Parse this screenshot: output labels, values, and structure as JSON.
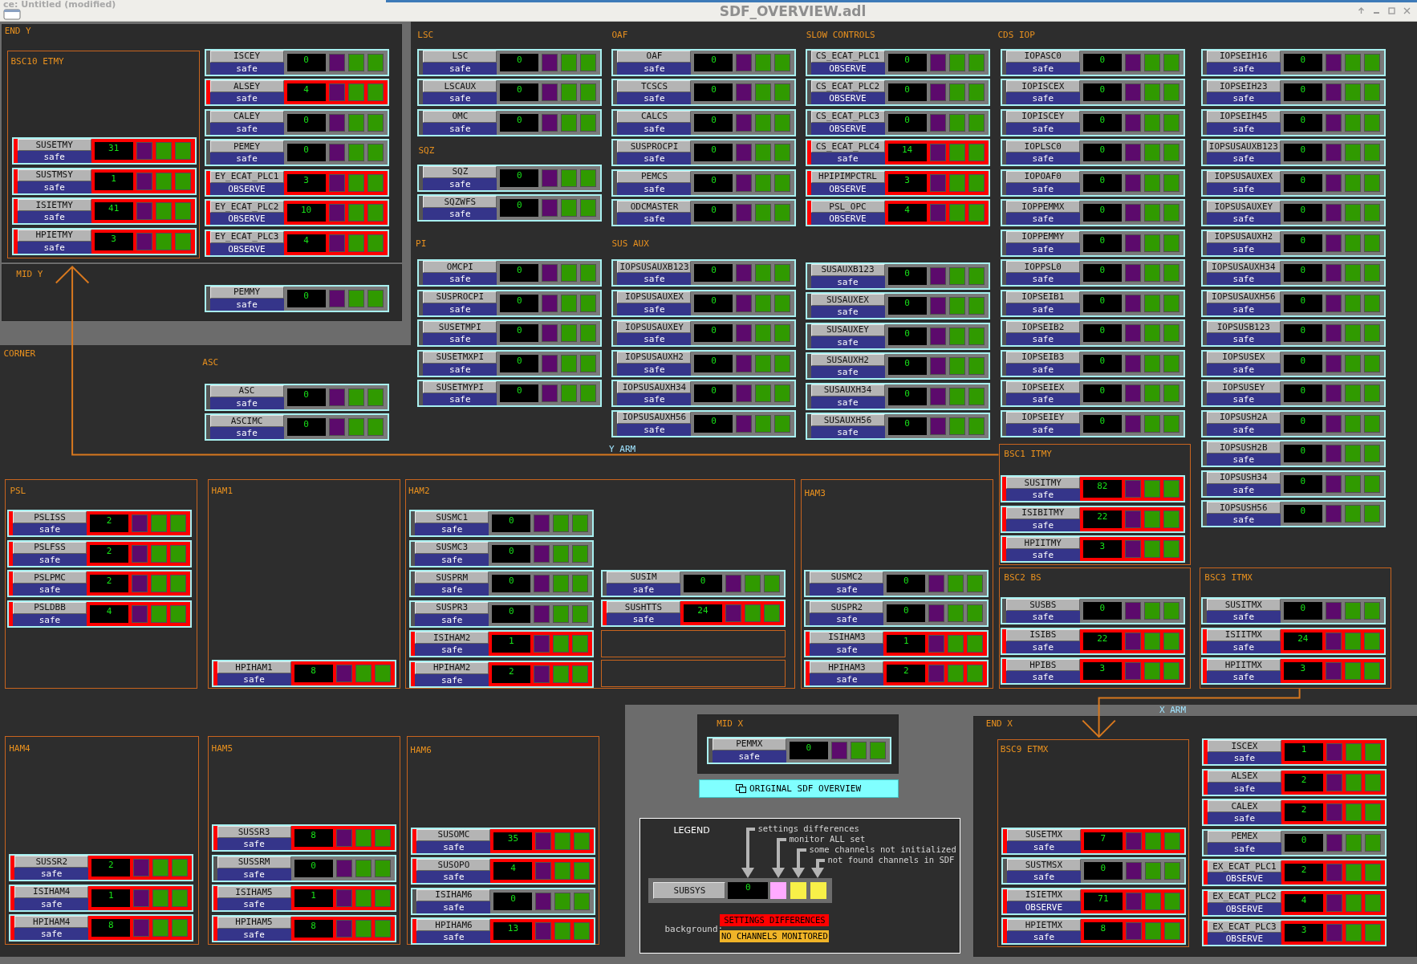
{
  "window": {
    "behind_title": "ce: Untitled (modified)",
    "title": "SDF_OVERVIEW.adl"
  },
  "sections": [
    {
      "kind": "panel",
      "label": "END Y"
    },
    {
      "kind": "box",
      "label": "BSC10 ETMY",
      "widgets": [
        {
          "name": "SUSETMY",
          "mode": "safe",
          "count": "31",
          "alarm": true
        },
        {
          "name": "SUSTMSY",
          "mode": "safe",
          "count": "1",
          "alarm": true
        },
        {
          "name": "ISIETMY",
          "mode": "safe",
          "count": "41",
          "alarm": true
        },
        {
          "name": "HPIETMY",
          "mode": "safe",
          "count": "3",
          "alarm": true
        }
      ]
    },
    {
      "kind": "column",
      "widgets": [
        {
          "name": "ISCEY",
          "mode": "safe",
          "count": "0",
          "alarm": false
        },
        {
          "name": "ALSEY",
          "mode": "safe",
          "count": "4",
          "alarm": true
        },
        {
          "name": "CALEY",
          "mode": "safe",
          "count": "0",
          "alarm": false
        },
        {
          "name": "PEMEY",
          "mode": "safe",
          "count": "0",
          "alarm": false
        },
        {
          "name": "EY_ECAT_PLC1",
          "mode": "OBSERVE",
          "count": "3",
          "alarm": true
        },
        {
          "name": "EY_ECAT_PLC2",
          "mode": "OBSERVE",
          "count": "10",
          "alarm": true
        },
        {
          "name": "EY_ECAT_PLC3",
          "mode": "OBSERVE",
          "count": "4",
          "alarm": true
        }
      ]
    },
    {
      "kind": "panel",
      "label": "MID Y"
    },
    {
      "kind": "column",
      "widgets": [
        {
          "name": "PEMMY",
          "mode": "safe",
          "count": "0",
          "alarm": false
        }
      ]
    },
    {
      "kind": "column",
      "label": "LSC",
      "widgets": [
        {
          "name": "LSC",
          "mode": "safe",
          "count": "0",
          "alarm": false
        },
        {
          "name": "LSCAUX",
          "mode": "safe",
          "count": "0",
          "alarm": false
        },
        {
          "name": "OMC",
          "mode": "safe",
          "count": "0",
          "alarm": false
        }
      ]
    },
    {
      "kind": "column",
      "label": "SQZ",
      "widgets": [
        {
          "name": "SQZ",
          "mode": "safe",
          "count": "0",
          "alarm": false
        },
        {
          "name": "SQZWFS",
          "mode": "safe",
          "count": "0",
          "alarm": false
        }
      ]
    },
    {
      "kind": "column",
      "label": "PI",
      "widgets": [
        {
          "name": "OMCPI",
          "mode": "safe",
          "count": "0",
          "alarm": false
        },
        {
          "name": "SUSPROCPI",
          "mode": "safe",
          "count": "0",
          "alarm": false
        },
        {
          "name": "SUSETMPI",
          "mode": "safe",
          "count": "0",
          "alarm": false
        },
        {
          "name": "SUSETMXPI",
          "mode": "safe",
          "count": "0",
          "alarm": false
        },
        {
          "name": "SUSETMYPI",
          "mode": "safe",
          "count": "0",
          "alarm": false
        }
      ]
    },
    {
      "kind": "column",
      "label": "OAF",
      "widgets": [
        {
          "name": "OAF",
          "mode": "safe",
          "count": "0",
          "alarm": false
        },
        {
          "name": "TCSCS",
          "mode": "safe",
          "count": "0",
          "alarm": false
        },
        {
          "name": "CALCS",
          "mode": "safe",
          "count": "0",
          "alarm": false
        },
        {
          "name": "SUSPROCPI",
          "mode": "safe",
          "count": "0",
          "alarm": false
        },
        {
          "name": "PEMCS",
          "mode": "safe",
          "count": "0",
          "alarm": false
        },
        {
          "name": "ODCMASTER",
          "mode": "safe",
          "count": "0",
          "alarm": false
        }
      ]
    },
    {
      "kind": "column",
      "label": "SUS AUX",
      "widgets": [
        {
          "name": "IOPSUSAUXB123",
          "mode": "safe",
          "count": "0",
          "alarm": false
        },
        {
          "name": "IOPSUSAUXEX",
          "mode": "safe",
          "count": "0",
          "alarm": false
        },
        {
          "name": "IOPSUSAUXEY",
          "mode": "safe",
          "count": "0",
          "alarm": false
        },
        {
          "name": "IOPSUSAUXH2",
          "mode": "safe",
          "count": "0",
          "alarm": false
        },
        {
          "name": "IOPSUSAUXH34",
          "mode": "safe",
          "count": "0",
          "alarm": false
        },
        {
          "name": "IOPSUSAUXH56",
          "mode": "safe",
          "count": "0",
          "alarm": false
        }
      ]
    },
    {
      "kind": "column",
      "label": "SLOW CONTROLS",
      "widgets": [
        {
          "name": "CS_ECAT_PLC1",
          "mode": "OBSERVE",
          "count": "0",
          "alarm": false
        },
        {
          "name": "CS_ECAT_PLC2",
          "mode": "OBSERVE",
          "count": "0",
          "alarm": false
        },
        {
          "name": "CS_ECAT_PLC3",
          "mode": "OBSERVE",
          "count": "0",
          "alarm": false
        },
        {
          "name": "CS_ECAT_PLC4",
          "mode": "safe",
          "count": "14",
          "alarm": true
        },
        {
          "name": "HPIPIMPCTRL",
          "mode": "OBSERVE",
          "count": "3",
          "alarm": true
        },
        {
          "name": "PSL_OPC",
          "mode": "OBSERVE",
          "count": "4",
          "alarm": true
        }
      ]
    },
    {
      "kind": "column",
      "widgets": [
        {
          "name": "SUSAUXB123",
          "mode": "safe",
          "count": "0",
          "alarm": false
        },
        {
          "name": "SUSAUXEX",
          "mode": "safe",
          "count": "0",
          "alarm": false
        },
        {
          "name": "SUSAUXEY",
          "mode": "safe",
          "count": "0",
          "alarm": false
        },
        {
          "name": "SUSAUXH2",
          "mode": "safe",
          "count": "0",
          "alarm": false
        },
        {
          "name": "SUSAUXH34",
          "mode": "safe",
          "count": "0",
          "alarm": false
        },
        {
          "name": "SUSAUXH56",
          "mode": "safe",
          "count": "0",
          "alarm": false
        }
      ]
    },
    {
      "kind": "column",
      "label": "CDS IOP",
      "widgets": [
        {
          "name": "IOPASC0",
          "mode": "safe",
          "count": "0",
          "alarm": false
        },
        {
          "name": "IOPISCEX",
          "mode": "safe",
          "count": "0",
          "alarm": false
        },
        {
          "name": "IOPISCEY",
          "mode": "safe",
          "count": "0",
          "alarm": false
        },
        {
          "name": "IOPLSC0",
          "mode": "safe",
          "count": "0",
          "alarm": false
        },
        {
          "name": "IOPOAF0",
          "mode": "safe",
          "count": "0",
          "alarm": false
        },
        {
          "name": "IOPPEMMX",
          "mode": "safe",
          "count": "0",
          "alarm": false
        },
        {
          "name": "IOPPEMMY",
          "mode": "safe",
          "count": "0",
          "alarm": false
        },
        {
          "name": "IOPPSL0",
          "mode": "safe",
          "count": "0",
          "alarm": false
        },
        {
          "name": "IOPSEIB1",
          "mode": "safe",
          "count": "0",
          "alarm": false
        },
        {
          "name": "IOPSEIB2",
          "mode": "safe",
          "count": "0",
          "alarm": false
        },
        {
          "name": "IOPSEIB3",
          "mode": "safe",
          "count": "0",
          "alarm": false
        },
        {
          "name": "IOPSEIEX",
          "mode": "safe",
          "count": "0",
          "alarm": false
        },
        {
          "name": "IOPSEIEY",
          "mode": "safe",
          "count": "0",
          "alarm": false
        }
      ]
    },
    {
      "kind": "column",
      "widgets": [
        {
          "name": "IOPSEIH16",
          "mode": "safe",
          "count": "0",
          "alarm": false
        },
        {
          "name": "IOPSEIH23",
          "mode": "safe",
          "count": "0",
          "alarm": false
        },
        {
          "name": "IOPSEIH45",
          "mode": "safe",
          "count": "0",
          "alarm": false
        },
        {
          "name": "IOPSUSAUXB123",
          "mode": "safe",
          "count": "0",
          "alarm": false
        },
        {
          "name": "IOPSUSAUXEX",
          "mode": "safe",
          "count": "0",
          "alarm": false
        },
        {
          "name": "IOPSUSAUXEY",
          "mode": "safe",
          "count": "0",
          "alarm": false
        },
        {
          "name": "IOPSUSAUXH2",
          "mode": "safe",
          "count": "0",
          "alarm": false
        },
        {
          "name": "IOPSUSAUXH34",
          "mode": "safe",
          "count": "0",
          "alarm": false
        },
        {
          "name": "IOPSUSAUXH56",
          "mode": "safe",
          "count": "0",
          "alarm": false
        },
        {
          "name": "IOPSUSB123",
          "mode": "safe",
          "count": "0",
          "alarm": false
        },
        {
          "name": "IOPSUSEX",
          "mode": "safe",
          "count": "0",
          "alarm": false
        },
        {
          "name": "IOPSUSEY",
          "mode": "safe",
          "count": "0",
          "alarm": false
        },
        {
          "name": "IOPSUSH2A",
          "mode": "safe",
          "count": "0",
          "alarm": false
        },
        {
          "name": "IOPSUSH2B",
          "mode": "safe",
          "count": "0",
          "alarm": false
        },
        {
          "name": "IOPSUSH34",
          "mode": "safe",
          "count": "0",
          "alarm": false
        },
        {
          "name": "IOPSUSH56",
          "mode": "safe",
          "count": "0",
          "alarm": false
        }
      ]
    },
    {
      "kind": "label",
      "label": "CORNER"
    },
    {
      "kind": "column",
      "label": "ASC",
      "widgets": [
        {
          "name": "ASC",
          "mode": "safe",
          "count": "0",
          "alarm": false
        },
        {
          "name": "ASCIMC",
          "mode": "safe",
          "count": "0",
          "alarm": false
        }
      ]
    },
    {
      "kind": "box",
      "label": "BSC1 ITMY",
      "widgets": [
        {
          "name": "SUSITMY",
          "mode": "safe",
          "count": "82",
          "alarm": true
        },
        {
          "name": "ISIBITMY",
          "mode": "safe",
          "count": "22",
          "alarm": true
        },
        {
          "name": "HPIITMY",
          "mode": "safe",
          "count": "3",
          "alarm": true
        }
      ]
    },
    {
      "kind": "arm",
      "label": "Y ARM"
    },
    {
      "kind": "box",
      "label": "PSL",
      "widgets": [
        {
          "name": "PSLISS",
          "mode": "safe",
          "count": "2",
          "alarm": true
        },
        {
          "name": "PSLFSS",
          "mode": "safe",
          "count": "2",
          "alarm": true
        },
        {
          "name": "PSLPMC",
          "mode": "safe",
          "count": "2",
          "alarm": true
        },
        {
          "name": "PSLDBB",
          "mode": "safe",
          "count": "4",
          "alarm": true
        }
      ]
    },
    {
      "kind": "box",
      "label": "HAM1",
      "widgets": [
        {
          "name": "HPIHAM1",
          "mode": "safe",
          "count": "8",
          "alarm": true
        }
      ]
    },
    {
      "kind": "box",
      "label": "HAM2",
      "widgets": [
        {
          "name": "SUSMC1",
          "mode": "safe",
          "count": "0",
          "alarm": false
        },
        {
          "name": "SUSMC3",
          "mode": "safe",
          "count": "0",
          "alarm": false
        },
        {
          "name": "SUSPRM",
          "mode": "safe",
          "count": "0",
          "alarm": false
        },
        {
          "name": "SUSPR3",
          "mode": "safe",
          "count": "0",
          "alarm": false
        },
        {
          "name": "ISIHAM2",
          "mode": "safe",
          "count": "1",
          "alarm": true
        },
        {
          "name": "HPIHAM2",
          "mode": "safe",
          "count": "2",
          "alarm": true
        }
      ]
    },
    {
      "kind": "column",
      "widgets": [
        {
          "name": "SUSIM",
          "mode": "safe",
          "count": "0",
          "alarm": false
        },
        {
          "name": "SUSHTTS",
          "mode": "safe",
          "count": "24",
          "alarm": true
        }
      ]
    },
    {
      "kind": "box",
      "label": "HAM3",
      "widgets": [
        {
          "name": "SUSMC2",
          "mode": "safe",
          "count": "0",
          "alarm": false
        },
        {
          "name": "SUSPR2",
          "mode": "safe",
          "count": "0",
          "alarm": false
        },
        {
          "name": "ISIHAM3",
          "mode": "safe",
          "count": "1",
          "alarm": true
        },
        {
          "name": "HPIHAM3",
          "mode": "safe",
          "count": "2",
          "alarm": true
        }
      ]
    },
    {
      "kind": "box",
      "label": "BSC2 BS",
      "widgets": [
        {
          "name": "SUSBS",
          "mode": "safe",
          "count": "0",
          "alarm": false
        },
        {
          "name": "ISIBS",
          "mode": "safe",
          "count": "22",
          "alarm": true
        },
        {
          "name": "HPIBS",
          "mode": "safe",
          "count": "3",
          "alarm": true
        }
      ]
    },
    {
      "kind": "box",
      "label": "BSC3 ITMX",
      "widgets": [
        {
          "name": "SUSITMX",
          "mode": "safe",
          "count": "0",
          "alarm": false
        },
        {
          "name": "ISIITMX",
          "mode": "safe",
          "count": "24",
          "alarm": true
        },
        {
          "name": "HPIITMX",
          "mode": "safe",
          "count": "3",
          "alarm": true
        }
      ]
    },
    {
      "kind": "arm",
      "label": "X ARM"
    },
    {
      "kind": "box",
      "label": "HAM4",
      "widgets": [
        {
          "name": "SUSSR2",
          "mode": "safe",
          "count": "2",
          "alarm": true
        },
        {
          "name": "ISIHAM4",
          "mode": "safe",
          "count": "1",
          "alarm": true
        },
        {
          "name": "HPIHAM4",
          "mode": "safe",
          "count": "8",
          "alarm": true
        }
      ]
    },
    {
      "kind": "box",
      "label": "HAM5",
      "widgets": [
        {
          "name": "SUSSR3",
          "mode": "safe",
          "count": "8",
          "alarm": true
        },
        {
          "name": "SUSSRM",
          "mode": "safe",
          "count": "0",
          "alarm": false
        },
        {
          "name": "ISIHAM5",
          "mode": "safe",
          "count": "1",
          "alarm": true
        },
        {
          "name": "HPIHAM5",
          "mode": "safe",
          "count": "8",
          "alarm": true
        }
      ]
    },
    {
      "kind": "box",
      "label": "HAM6",
      "widgets": [
        {
          "name": "SUSOMC",
          "mode": "safe",
          "count": "35",
          "alarm": true
        },
        {
          "name": "SUSOPO",
          "mode": "safe",
          "count": "4",
          "alarm": true
        },
        {
          "name": "ISIHAM6",
          "mode": "safe",
          "count": "0",
          "alarm": false
        },
        {
          "name": "HPIHAM6",
          "mode": "safe",
          "count": "13",
          "alarm": true
        }
      ]
    },
    {
      "kind": "panel",
      "label": "MID X",
      "widgets": [
        {
          "name": "PEMMX",
          "mode": "safe",
          "count": "0",
          "alarm": false
        }
      ]
    },
    {
      "kind": "button",
      "label": "ORIGINAL SDF OVERVIEW"
    },
    {
      "kind": "legend",
      "title": "LEGEND",
      "notes": [
        "settings differences",
        "monitor ALL set",
        "some channels not initialized",
        "not found channels in SDF"
      ],
      "sample": {
        "name": "SUBSYS",
        "count": "0"
      },
      "indicators": [
        {
          "color": "#ffaaff"
        },
        {
          "color": "#f8f048"
        },
        {
          "color": "#f8f048"
        }
      ],
      "background_label": "background:",
      "tags": [
        {
          "text": "SETTINGS DIFFERENCES",
          "color": "#ff0000"
        },
        {
          "text": "NO CHANNELS MONITORED",
          "color": "#f0b428"
        }
      ]
    },
    {
      "kind": "panel",
      "label": "END X"
    },
    {
      "kind": "box",
      "label": "BSC9 ETMX",
      "widgets": [
        {
          "name": "SUSETMX",
          "mode": "safe",
          "count": "7",
          "alarm": true
        },
        {
          "name": "SUSTMSX",
          "mode": "safe",
          "count": "0",
          "alarm": false
        },
        {
          "name": "ISIETMX",
          "mode": "OBSERVE",
          "count": "71",
          "alarm": true
        },
        {
          "name": "HPIETMX",
          "mode": "safe",
          "count": "8",
          "alarm": true
        }
      ]
    },
    {
      "kind": "column",
      "widgets": [
        {
          "name": "ISCEX",
          "mode": "safe",
          "count": "1",
          "alarm": true
        },
        {
          "name": "ALSEX",
          "mode": "safe",
          "count": "2",
          "alarm": true
        },
        {
          "name": "CALEX",
          "mode": "safe",
          "count": "2",
          "alarm": true
        },
        {
          "name": "PEMEX",
          "mode": "safe",
          "count": "0",
          "alarm": false
        },
        {
          "name": "EX_ECAT_PLC1",
          "mode": "OBSERVE",
          "count": "2",
          "alarm": true
        },
        {
          "name": "EX_ECAT_PLC2",
          "mode": "OBSERVE",
          "count": "4",
          "alarm": true
        },
        {
          "name": "EX_ECAT_PLC3",
          "mode": "OBSERVE",
          "count": "3",
          "alarm": true
        }
      ]
    }
  ]
}
